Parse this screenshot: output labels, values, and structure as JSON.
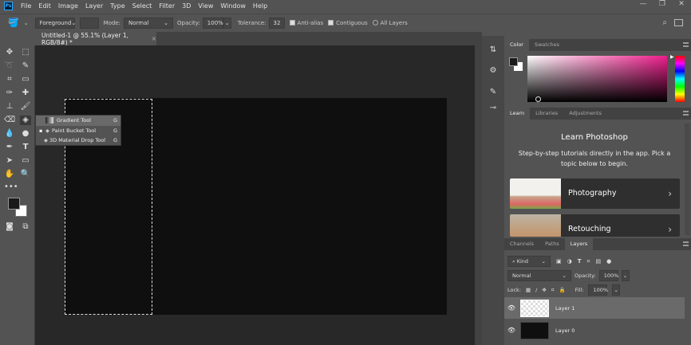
{
  "app": {
    "logo": "Ps"
  },
  "menu": [
    "File",
    "Edit",
    "Image",
    "Layer",
    "Type",
    "Select",
    "Filter",
    "3D",
    "View",
    "Window",
    "Help"
  ],
  "window_controls": {
    "minimize": "—",
    "restore": "❐",
    "close": "✕"
  },
  "options": {
    "fill_source": "Foreground",
    "mode_label": "Mode:",
    "mode": "Normal",
    "opacity_label": "Opacity:",
    "opacity": "100%",
    "tolerance_label": "Tolerance:",
    "tolerance": "32",
    "anti_alias": "Anti-alias",
    "anti_alias_checked": true,
    "contiguous": "Contiguous",
    "contiguous_checked": true,
    "all_layers": "All Layers",
    "all_layers_checked": false
  },
  "document": {
    "tab_title": "Untitled-1 @ 55.1% (Layer 1, RGB/8#) *",
    "close": "×",
    "canvas_color": "#100f10"
  },
  "flyout": [
    {
      "label": "Gradient Tool",
      "key": "G"
    },
    {
      "label": "Paint Bucket Tool",
      "key": "G",
      "active": true
    },
    {
      "label": "3D Material Drop Tool",
      "key": "G"
    }
  ],
  "color_panel": {
    "tabs": [
      "Color",
      "Swatches"
    ],
    "foreground": "#1a1a1a",
    "background": "#ffffff",
    "hue_color": "#ee1e8c"
  },
  "learn_panel": {
    "tabs": [
      "Learn",
      "Libraries",
      "Adjustments"
    ],
    "title": "Learn Photoshop",
    "subtitle": "Step-by-step tutorials directly in the app. Pick a topic below to begin.",
    "cards": [
      {
        "label": "Photography"
      },
      {
        "label": "Retouching"
      }
    ]
  },
  "layers_panel": {
    "tabs": [
      "Channels",
      "Paths",
      "Layers"
    ],
    "filter": "Kind",
    "blend": "Normal",
    "opacity_label": "Opacity:",
    "opacity": "100%",
    "lock_label": "Lock:",
    "fill_label": "Fill:",
    "fill": "100%",
    "layers": [
      {
        "name": "Layer 1",
        "selected": true
      },
      {
        "name": "Layer 0",
        "selected": false
      }
    ]
  }
}
